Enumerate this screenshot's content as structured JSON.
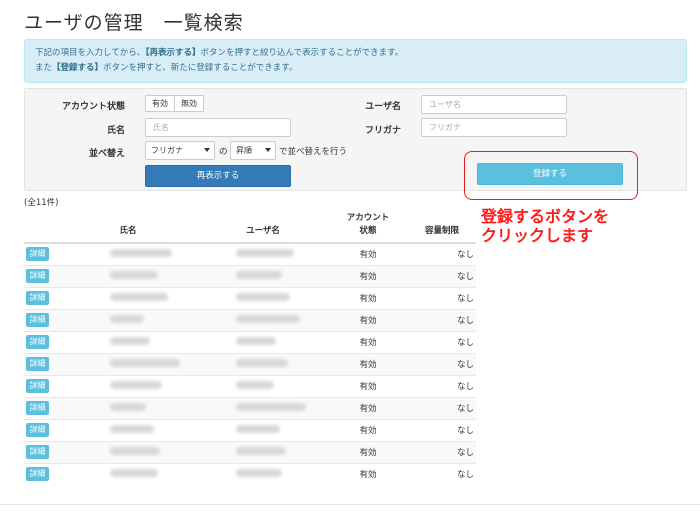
{
  "page": {
    "title": "ユーザの管理　一覧検索"
  },
  "info": {
    "line1_pre": "下記の項目を入力してから、",
    "line1_bold": "【再表示する】",
    "line1_post": "ボタンを押すと絞り込んで表示することができます。",
    "line2_pre": "また",
    "line2_bold": "【登録する】",
    "line2_post": "ボタンを押すと、新たに登録することができます。"
  },
  "form": {
    "account_status_label": "アカウント状態",
    "status_enabled": "有効",
    "status_disabled": "無効",
    "name_label": "氏名",
    "name_placeholder": "氏名",
    "username_label": "ユーザ名",
    "username_placeholder": "ユーザ名",
    "furigana_label": "フリガナ",
    "furigana_placeholder": "フリガナ",
    "sort_label": "並べ替え",
    "sort_field_value": "フリガナ",
    "sort_no": "の",
    "sort_order_value": "昇順",
    "sort_suffix": "で並べ替えを行う",
    "refresh_button": "再表示する",
    "register_button": "登録する"
  },
  "callout": {
    "text": "登録するボタンを\nクリックします"
  },
  "results": {
    "count": "(全11件)",
    "headers": {
      "name": "氏名",
      "username": "ユーザ名",
      "status": "アカウント\n状態",
      "quota": "容量制限"
    },
    "detail_label": "詳細",
    "rows": [
      {
        "status": "有効",
        "quota": "なし"
      },
      {
        "status": "有効",
        "quota": "なし"
      },
      {
        "status": "有効",
        "quota": "なし"
      },
      {
        "status": "有効",
        "quota": "なし"
      },
      {
        "status": "有効",
        "quota": "なし"
      },
      {
        "status": "有効",
        "quota": "なし"
      },
      {
        "status": "有効",
        "quota": "なし"
      },
      {
        "status": "有効",
        "quota": "なし"
      },
      {
        "status": "有効",
        "quota": "なし"
      },
      {
        "status": "有効",
        "quota": "なし"
      },
      {
        "status": "有効",
        "quota": "なし"
      }
    ]
  }
}
